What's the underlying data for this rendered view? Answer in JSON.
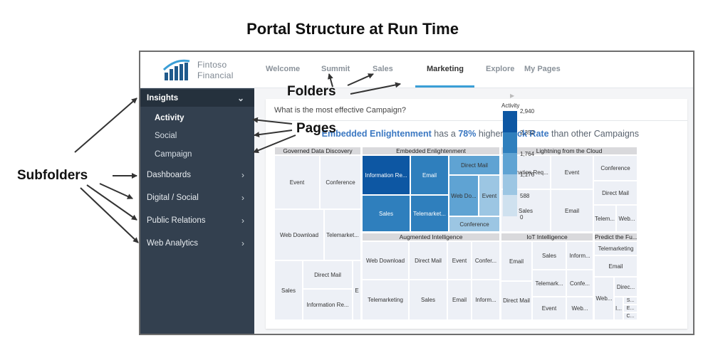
{
  "diagram_title": "Portal Structure at Run Time",
  "callouts": {
    "folders": "Folders",
    "pages": "Pages",
    "subfolders": "Subfolders"
  },
  "app": {
    "brand_line1": "Fintoso",
    "brand_line2": "Financial",
    "nav_tabs": [
      "Welcome",
      "Summit",
      "Sales",
      "Marketing",
      "Explore",
      "My Pages"
    ],
    "active_tab": "Marketing"
  },
  "sidebar": {
    "folder": "Insights",
    "pages": [
      "Activity",
      "Social",
      "Campaign"
    ],
    "active_page": "Activity",
    "subfolders": [
      "Dashboards",
      "Digital / Social",
      "Public Relations",
      "Web Analytics"
    ]
  },
  "content": {
    "question": "What is the most effective Campaign?",
    "headline": {
      "highlight1": "Embedded Enlightenment",
      "text1": " has a ",
      "highlight2": "78%",
      "text2": " higher ",
      "highlight3": "Click Rate",
      "text3": " than other Campaigns"
    }
  },
  "treemap": {
    "groups": [
      "Governed Data Discovery",
      "Embedded Enlightenment",
      "Lightning from the Cloud",
      "Augmented Intelligence",
      "IoT Intelligence",
      "Predict the Fu..."
    ],
    "cells": {
      "gdd": [
        "Event",
        "Conference",
        "Web Download",
        "Telemarket...",
        "Sales",
        "Direct Mail",
        "Information Re...",
        "E"
      ],
      "ee": [
        "Information Re...",
        "Email",
        "Direct Mail",
        "Web Do...",
        "Event",
        "Sales",
        "Telemarket...",
        "Conference"
      ],
      "lc": [
        "Information Req...",
        "Event",
        "Conference",
        "Direct Mail",
        "Sales",
        "Email",
        "Telem...",
        "Web..."
      ],
      "ai": [
        "Web Download",
        "Direct Mail",
        "Event",
        "Confer...",
        "Telemarketing",
        "Sales",
        "Email",
        "Inform..."
      ],
      "iot": [
        "Email",
        "Sales",
        "Inform...",
        "Telemark...",
        "Confe...",
        "Direct Mail",
        "Event",
        "Web..."
      ],
      "pf": [
        "Telemarketing",
        "Email",
        "Web...",
        "Direc...",
        "I...",
        "S...",
        "E...",
        "C..."
      ]
    }
  },
  "legend": {
    "title": "Activity",
    "ticks": [
      "2,940",
      "2,352",
      "1,764",
      "1,176",
      "588",
      "0"
    ],
    "colors": [
      "#0d57a3",
      "#2f7fbd",
      "#5fa3d3",
      "#9cc6e3",
      "#cfe1ef"
    ]
  }
}
